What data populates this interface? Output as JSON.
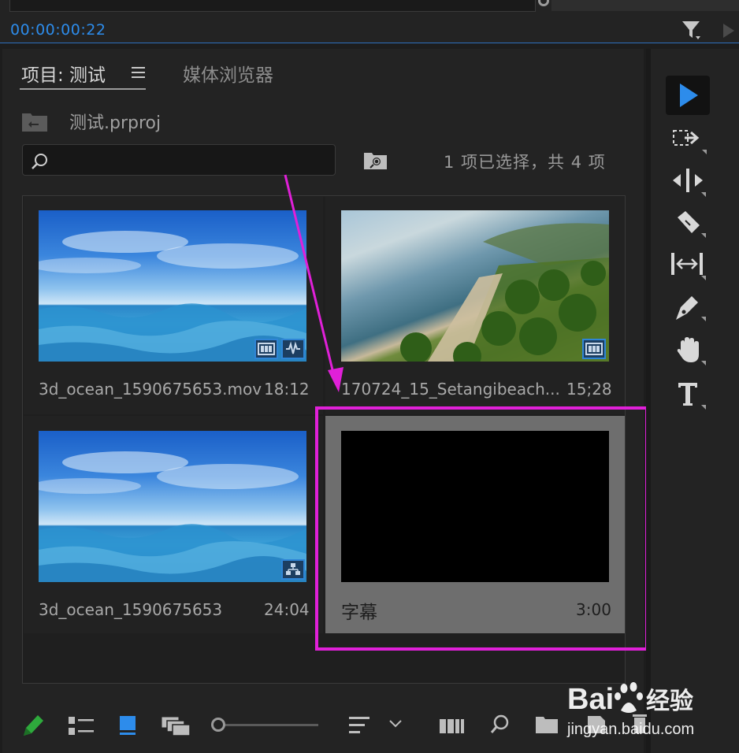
{
  "timecode": "00:00:00:22",
  "tabs": [
    {
      "label": "项目: 测试"
    },
    {
      "label": "媒体浏览器"
    }
  ],
  "project": {
    "file_name": "测试.prproj",
    "search_placeholder": "",
    "selection_status": "1 项已选择，共 4 项"
  },
  "items": [
    {
      "name": "3d_ocean_1590675653.mov",
      "duration": "18:12",
      "badges": [
        "video-icon",
        "audio-icon"
      ]
    },
    {
      "name": "170724_15_Setangibeach...",
      "duration": "15;28",
      "badges": [
        "video-icon"
      ]
    },
    {
      "name": "3d_ocean_1590675653",
      "duration": "24:04",
      "badges": [
        "sequence-icon"
      ]
    },
    {
      "name": "字幕",
      "duration": "3:00",
      "badges": [],
      "selected": true
    }
  ],
  "tools": [
    "selection-tool-icon",
    "track-select-tool-icon",
    "ripple-edit-tool-icon",
    "razor-tool-icon",
    "slip-tool-icon",
    "pen-tool-icon",
    "hand-tool-icon",
    "type-tool-icon"
  ],
  "watermark": {
    "brand": "Baidu经验",
    "url": "jingyan.baidu.com"
  },
  "colors": {
    "accent": "#2d8ceb",
    "annotation": "#e020d8",
    "selected_tile": "#6e6e6e"
  }
}
